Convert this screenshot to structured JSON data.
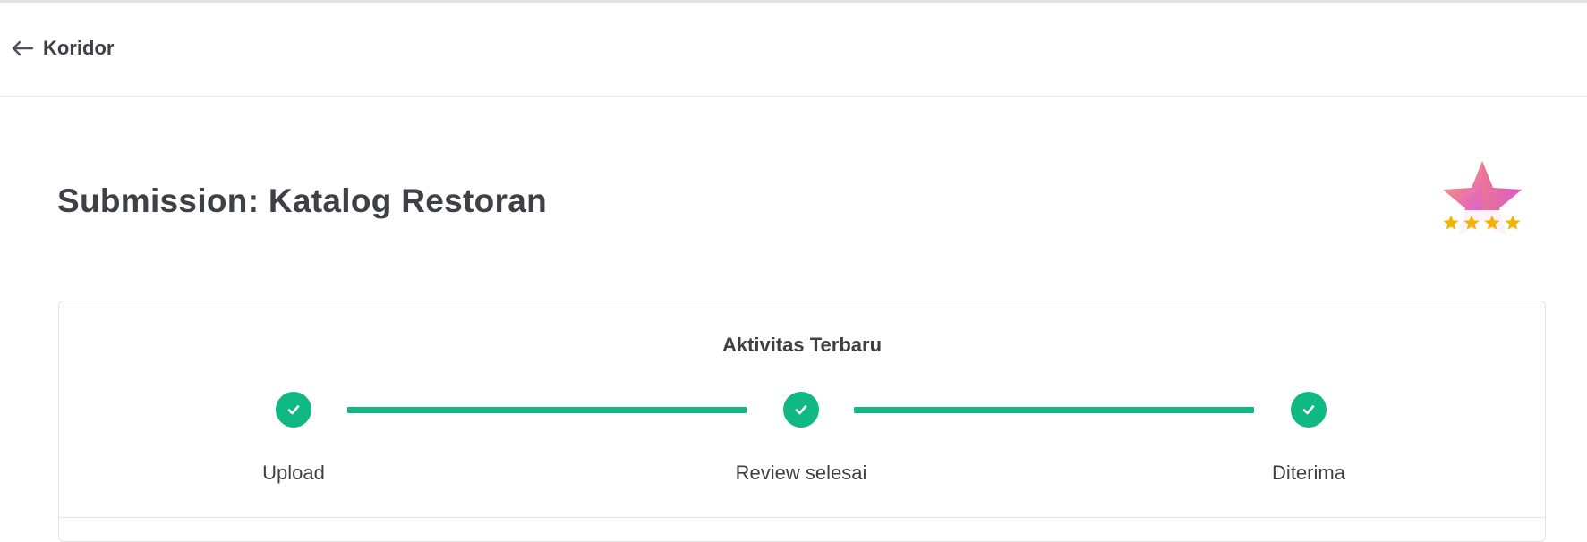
{
  "header": {
    "back_label": "Koridor",
    "back_icon": "arrow-left-icon"
  },
  "page": {
    "title": "Submission: Katalog Restoran"
  },
  "badge": {
    "icon": "star-rating-badge-icon",
    "stars": 4,
    "star_color": "#f5b301"
  },
  "activity": {
    "title": "Aktivitas Terbaru",
    "accent_color": "#10b981",
    "steps": [
      {
        "label": "Upload",
        "status": "done"
      },
      {
        "label": "Review selesai",
        "status": "done"
      },
      {
        "label": "Diterima",
        "status": "done"
      }
    ]
  }
}
